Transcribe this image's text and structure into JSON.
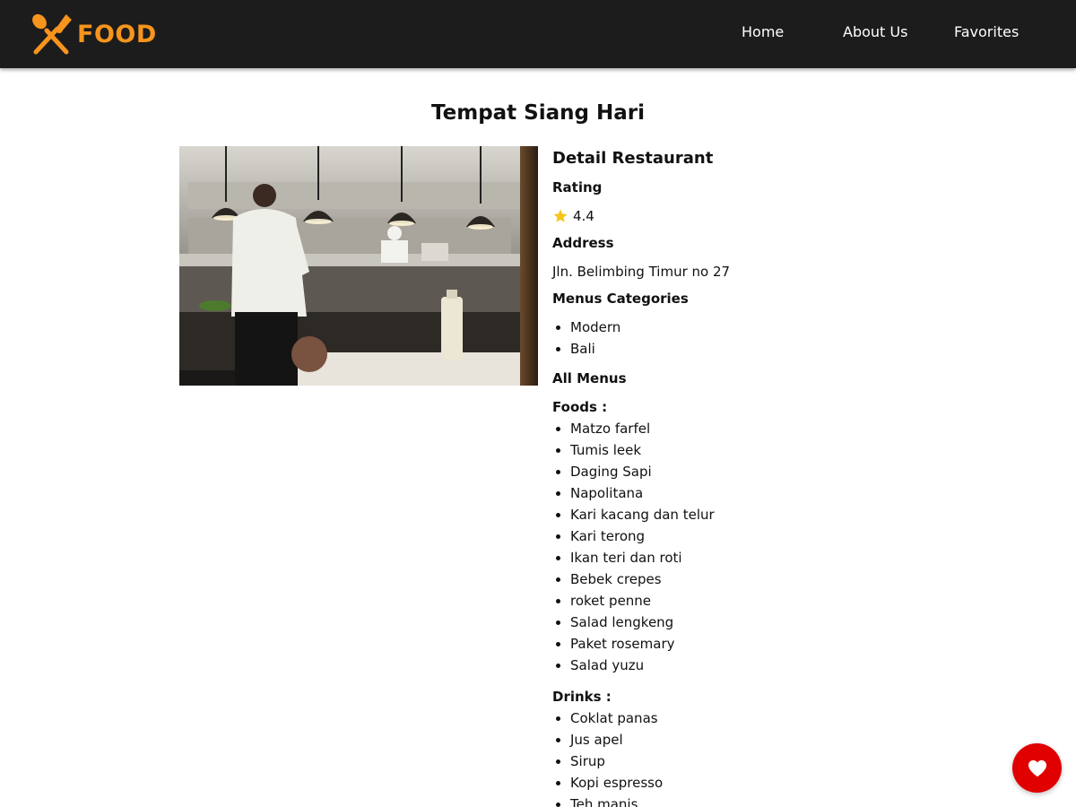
{
  "header": {
    "brand": "FOOD",
    "brand_icon": "fork-spoon-icon",
    "brand_color": "#f7941d",
    "background_color": "#1c1c1c",
    "nav": [
      {
        "label": "Home"
      },
      {
        "label": "About Us"
      },
      {
        "label": "Favorites"
      }
    ]
  },
  "restaurant": {
    "name": "Tempat Siang Hari",
    "image_icon": "restaurant-kitchen-photo",
    "detail_heading": "Detail Restaurant",
    "rating_label": "Rating",
    "rating_value": "4.4",
    "address_label": "Address",
    "address": "Jln. Belimbing Timur no 27",
    "categories_label": "Menus Categories",
    "categories": [
      "Modern",
      "Bali"
    ],
    "all_menus_label": "All Menus",
    "foods_label": "Foods :",
    "foods": [
      "Matzo farfel",
      "Tumis leek",
      "Daging Sapi",
      "Napolitana",
      "Kari kacang dan telur",
      "Kari terong",
      "Ikan teri dan roti",
      "Bebek crepes",
      "roket penne",
      "Salad lengkeng",
      "Paket rosemary",
      "Salad yuzu"
    ],
    "drinks_label": "Drinks :",
    "drinks": [
      "Coklat panas",
      "Jus apel",
      "Sirup",
      "Kopi espresso",
      "Teh manis"
    ]
  },
  "favorite_button": {
    "icon": "heart-icon",
    "color": "#e00000"
  }
}
